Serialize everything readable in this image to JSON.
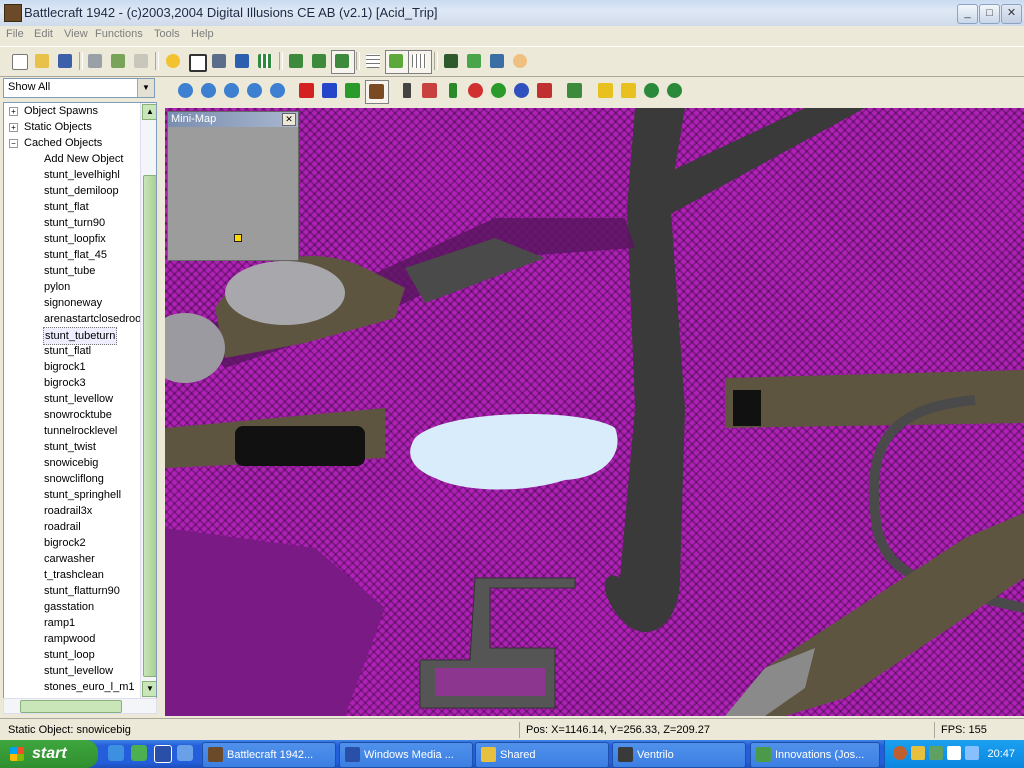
{
  "window": {
    "title": "Battlecraft 1942 - (c)2003,2004 Digital Illusions CE AB (v2.1) [Acid_Trip]",
    "minimize_glyph": "_",
    "maximize_glyph": "□",
    "close_glyph": "✕"
  },
  "menu": {
    "items": [
      "File",
      "Edit",
      "View",
      "Functions",
      "Tools",
      "Help"
    ]
  },
  "filter": {
    "value": "Show All",
    "arrow": "▼"
  },
  "tree": {
    "groups": [
      {
        "label": "Object Spawns",
        "expander": "+"
      },
      {
        "label": "Static Objects",
        "expander": "+"
      },
      {
        "label": "Cached Objects",
        "expander": "−"
      }
    ],
    "cached_items": [
      "Add New Object",
      "stunt_levelhighl",
      "stunt_demiloop",
      "stunt_flat",
      "stunt_turn90",
      "stunt_loopfix",
      "stunt_flat_45",
      "stunt_tube",
      "pylon",
      "signoneway",
      "arenastartclosedroo",
      "stunt_tubeturn",
      "stunt_flatl",
      "bigrock1",
      "bigrock3",
      "stunt_levellow",
      "snowrocktube",
      "tunnelrocklevel",
      "stunt_twist",
      "snowicebig",
      "snowcliflong",
      "stunt_springhell",
      "roadrail3x",
      "roadrail",
      "bigrock2",
      "carwasher",
      "t_trashclean",
      "stunt_flatturn90",
      "gasstation",
      "ramp1",
      "rampwood",
      "stunt_loop",
      "stunt_levellow",
      "stones_euro_l_m1"
    ],
    "selected_item": "stunt_tubeturn"
  },
  "minimap": {
    "title": "Mini-Map",
    "close_glyph": "✕"
  },
  "status": {
    "object": "Static Object: snowicebig",
    "position": "Pos: X=1146.14, Y=256.33, Z=209.27",
    "fps": "FPS: 155"
  },
  "taskbar": {
    "start_label": "start",
    "tasks": [
      {
        "label": "Battlecraft 1942...",
        "icon": "battlecraft-icon"
      },
      {
        "label": "Windows Media ...",
        "icon": "media-player-icon"
      },
      {
        "label": "Shared",
        "icon": "folder-icon"
      },
      {
        "label": "Ventrilo",
        "icon": "ventrilo-icon"
      },
      {
        "label": "Innovations (Jos...",
        "icon": "messenger-icon"
      }
    ],
    "clock": "20:47"
  },
  "colors": {
    "viewport_background": "#b021b8",
    "taskbar": "#245edb",
    "start_button": "#3ea63e"
  }
}
